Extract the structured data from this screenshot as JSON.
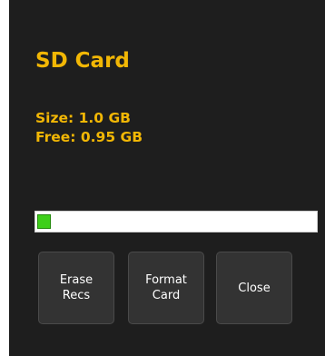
{
  "panel": {
    "title": "SD Card",
    "size_text": "Size: 1.0 GB",
    "free_text": "Free: 0.95 GB"
  },
  "storage": {
    "used_fraction": 0.05,
    "fill_color": "#3ecf1a",
    "accent_color": "#f2b705"
  },
  "buttons": {
    "erase_label": "Erase\nRecs",
    "format_label": "Format\nCard",
    "close_label": "Close"
  }
}
